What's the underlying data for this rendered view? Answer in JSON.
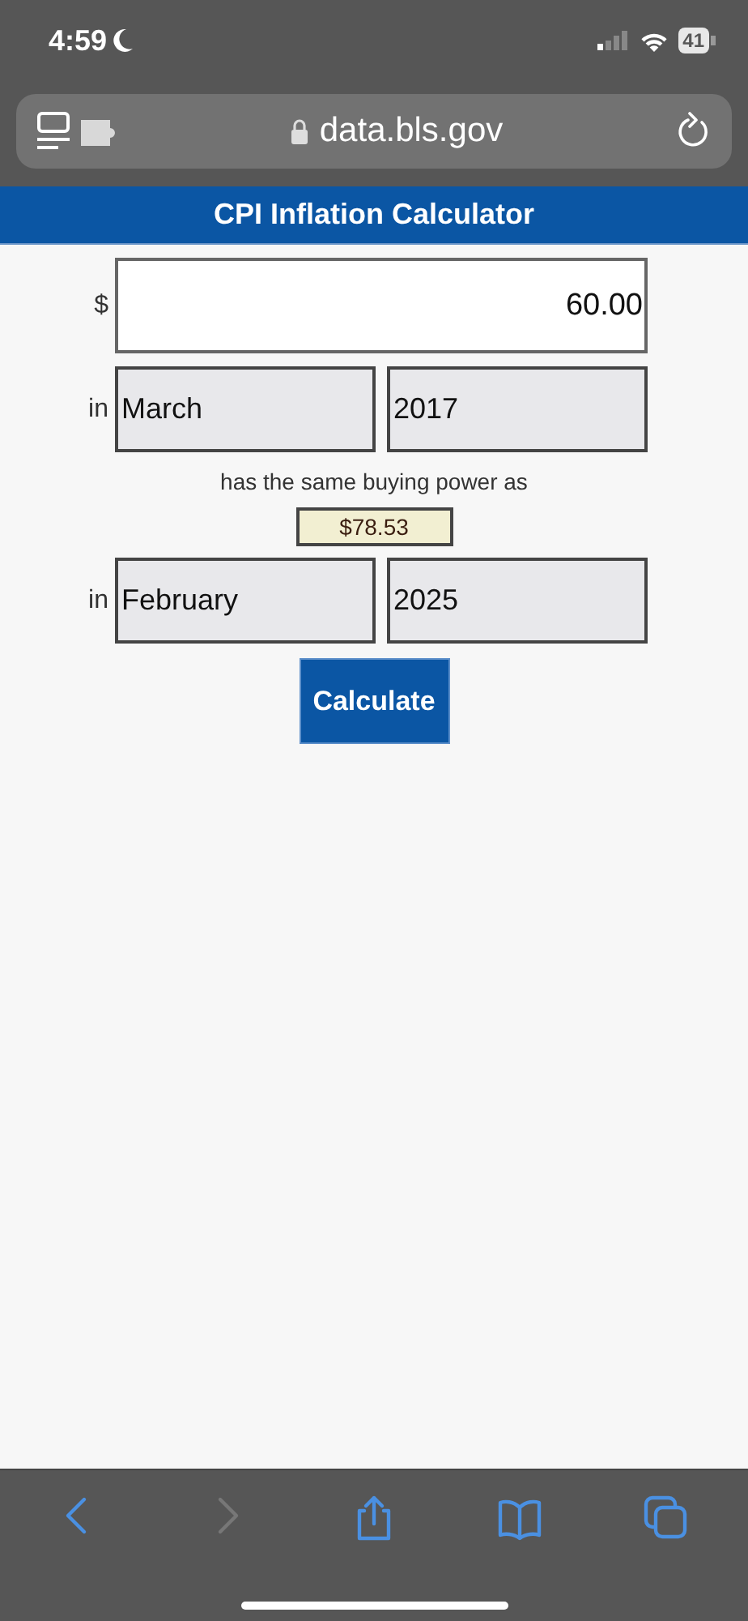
{
  "status_bar": {
    "time": "4:59",
    "battery": "41"
  },
  "address_bar": {
    "url": "data.bls.gov"
  },
  "header": {
    "title": "CPI Inflation Calculator"
  },
  "form": {
    "amount_label": "$",
    "amount": "60.00",
    "from": {
      "prefix": "in",
      "month": "March",
      "year": "2017"
    },
    "comparison": "has the same buying power as",
    "result": "$78.53",
    "to": {
      "prefix": "in",
      "month": "February",
      "year": "2025"
    },
    "button": "Calculate"
  },
  "toolbar": [
    {
      "kind": "back",
      "disabled": false
    },
    {
      "kind": "forward",
      "disabled": true
    },
    {
      "kind": "share",
      "disabled": false
    },
    {
      "kind": "bookmarks",
      "disabled": false
    },
    {
      "kind": "tabs",
      "disabled": false
    }
  ]
}
